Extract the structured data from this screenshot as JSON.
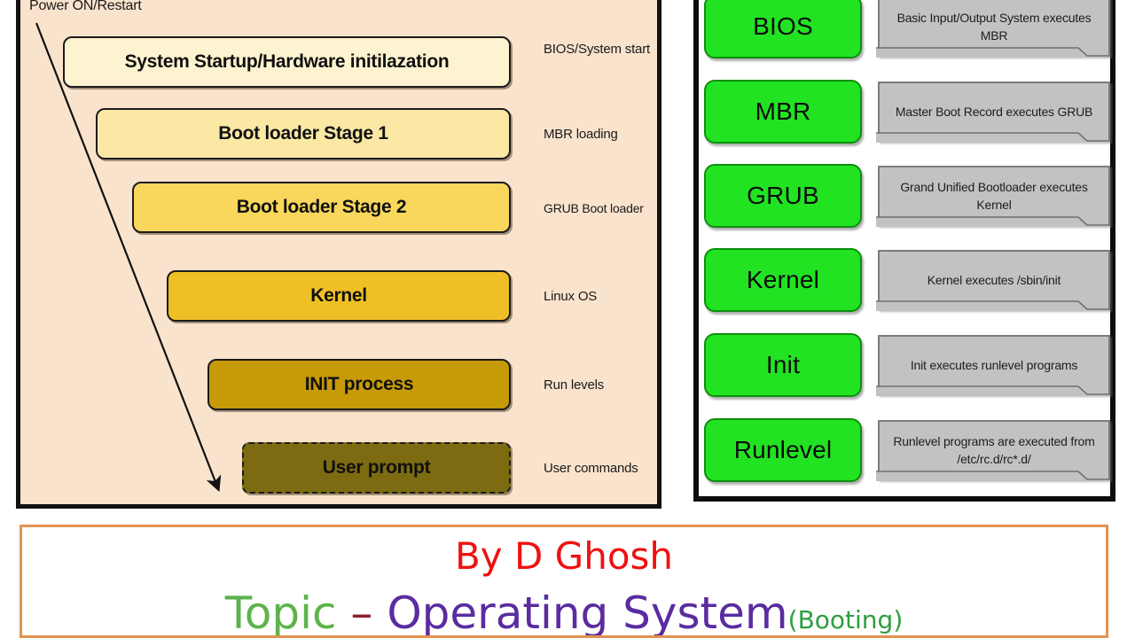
{
  "left_panel": {
    "power_label": "Power ON/Restart",
    "background_color": "#fae3cd",
    "arrow_icon": "down-right-arrow-icon",
    "stages": [
      {
        "label": "System Startup/Hardware initilazation",
        "note": "BIOS/System start",
        "color": "#fdf3d0"
      },
      {
        "label": "Boot loader Stage 1",
        "note": "MBR loading",
        "color": "#fae8a4"
      },
      {
        "label": "Boot loader Stage 2",
        "note": "GRUB Boot loader",
        "color": "#f9d65c"
      },
      {
        "label": "Kernel",
        "note": "Linux OS",
        "color": "#efc026"
      },
      {
        "label": "INIT process",
        "note": "Run levels",
        "color": "#c79a07"
      },
      {
        "label": "User prompt",
        "note": "User commands",
        "color": "#7d6b11"
      }
    ]
  },
  "right_panel": {
    "key_color": "#22e322",
    "desc_color": "#c2c2c2",
    "chain": [
      {
        "key": "BIOS",
        "desc": "Basic Input/Output System executes MBR"
      },
      {
        "key": "MBR",
        "desc": "Master Boot Record executes GRUB"
      },
      {
        "key": "GRUB",
        "desc": "Grand Unified Bootloader executes Kernel"
      },
      {
        "key": "Kernel",
        "desc": "Kernel executes /sbin/init"
      },
      {
        "key": "Init",
        "desc": "Init executes runlevel programs"
      },
      {
        "key": "Runlevel",
        "desc": "Runlevel programs are executed from /etc/rc.d/rc*.d/"
      }
    ]
  },
  "title_box": {
    "border_color": "#e39350",
    "author": "By D Ghosh",
    "author_color": "#ef1111",
    "topic_word": "Topic",
    "topic_word_color": "#5db34b",
    "dash": " – ",
    "dash_color": "#8f1f2e",
    "subject": "Operating System",
    "subject_color": "#5a2ca0",
    "parenthetical": "(Booting)",
    "parenthetical_color": "#2f9e3f"
  }
}
